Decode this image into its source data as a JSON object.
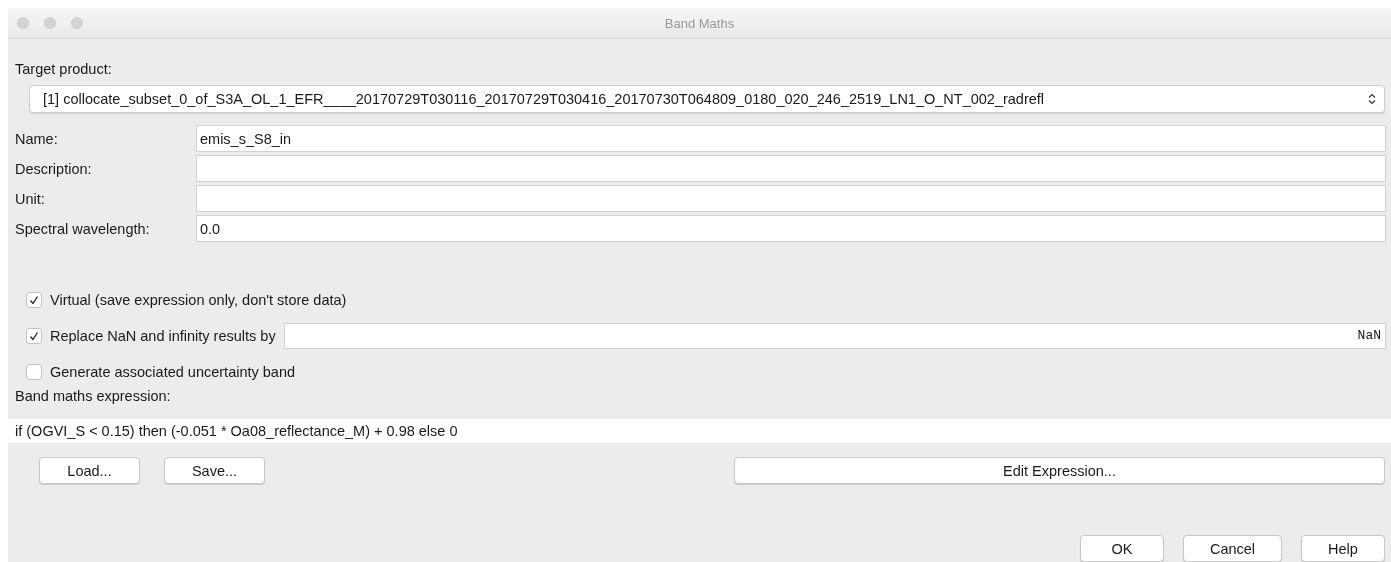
{
  "window": {
    "title": "Band Maths"
  },
  "target_product": {
    "label": "Target product:",
    "value": "[1] collocate_subset_0_of_S3A_OL_1_EFR____20170729T030116_20170729T030416_20170730T064809_0180_020_246_2519_LN1_O_NT_002_radrefl"
  },
  "fields": [
    {
      "label": "Name:",
      "value": "emis_s_S8_in"
    },
    {
      "label": "Description:"
    },
    {
      "label": "Unit:"
    },
    {
      "label": "Spectral wavelength:",
      "value": "0.0"
    }
  ],
  "options": [
    {
      "kind": "checkbox",
      "label": "Virtual (save expression only, don't store data)",
      "checked": true
    },
    {
      "kind": "checkbox_field",
      "label": "Replace NaN and infinity results by",
      "checked": true,
      "value": "NaN"
    },
    {
      "kind": "checkbox",
      "label": "Generate associated uncertainty band",
      "checked": false
    }
  ],
  "expression": {
    "label": "Band maths expression:",
    "value": "if (OGVI_S < 0.15) then (-0.051 * Oa08_reflectance_M) + 0.98 else 0"
  },
  "file_buttons": [
    "Load...",
    "Save..."
  ],
  "edit_button": "Edit Expression...",
  "dialog_buttons": [
    "OK",
    "Cancel",
    "Help"
  ]
}
